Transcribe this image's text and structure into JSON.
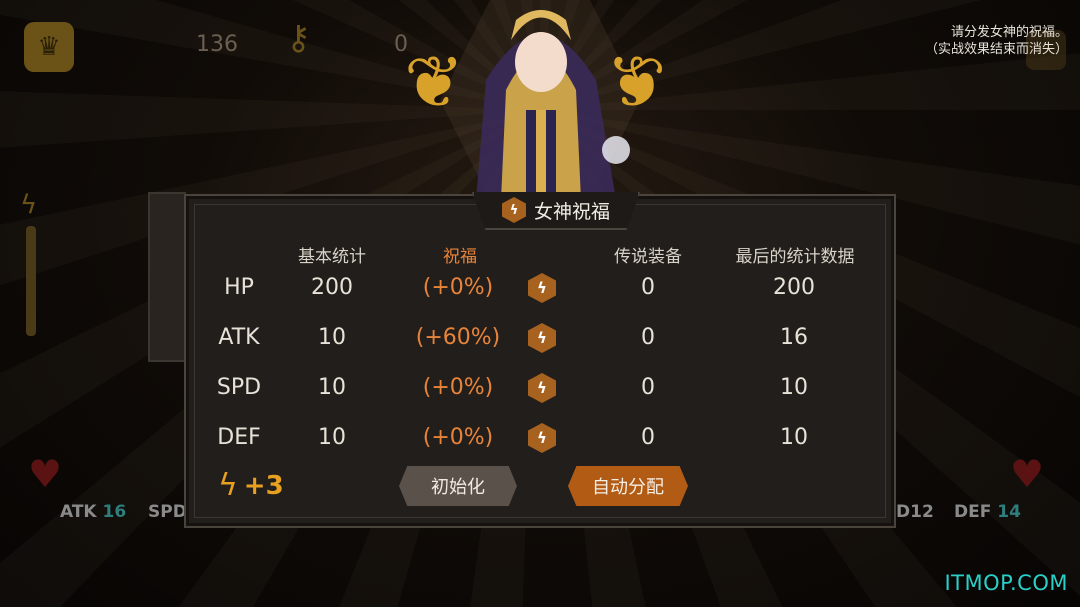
{
  "hud": {
    "gold_count": "136",
    "key_count": "0"
  },
  "hint": {
    "line1": "请分发女神的祝福。",
    "line2": "（实战效果结束而消失）"
  },
  "background_stats": [
    {
      "label": "ATK",
      "value": "16"
    },
    {
      "label": "SPD",
      "value": ""
    },
    {
      "label": "",
      "value": "D12"
    },
    {
      "label": "DEF",
      "value": "14"
    }
  ],
  "dialog": {
    "title": "女神祝福",
    "headers": {
      "base": "基本统计",
      "blessing": "祝福",
      "legendary": "传说装备",
      "final": "最后的统计数据"
    },
    "rows": [
      {
        "stat": "HP",
        "base": "200",
        "blessing": "(+0%)",
        "legendary": "0",
        "final": "200"
      },
      {
        "stat": "ATK",
        "base": "10",
        "blessing": "(+60%)",
        "legendary": "0",
        "final": "16"
      },
      {
        "stat": "SPD",
        "base": "10",
        "blessing": "(+0%)",
        "legendary": "0",
        "final": "10"
      },
      {
        "stat": "DEF",
        "base": "10",
        "blessing": "(+0%)",
        "legendary": "0",
        "final": "10"
      }
    ],
    "points": "+3",
    "reset_label": "初始化",
    "auto_label": "自动分配"
  },
  "watermark": "ITMOP.COM",
  "colors": {
    "accent_orange": "#e8843a",
    "button_orange": "#b25b14",
    "button_gray": "#5a514a",
    "teal_value": "#2f7d7d"
  },
  "icons": {
    "blessing_add": "lightning-hex-icon",
    "points": "lightning-icon",
    "gold": "crown-icon",
    "key": "key-icon"
  }
}
